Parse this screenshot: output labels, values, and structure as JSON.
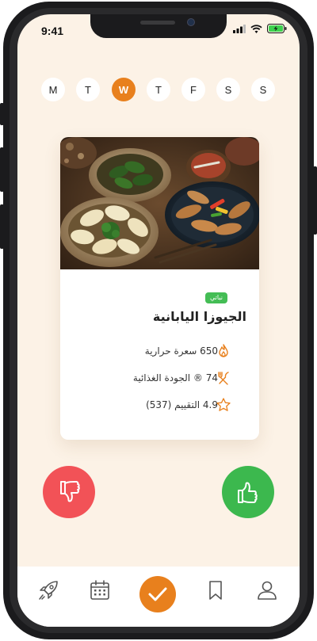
{
  "status_bar": {
    "time": "9:41"
  },
  "week": {
    "days": [
      "M",
      "T",
      "W",
      "T",
      "F",
      "S",
      "S"
    ],
    "selected": "W"
  },
  "dish": {
    "tag": "نباتي",
    "title": "الجيوزا اليابانية",
    "calories": "650 سعرة حرارية",
    "nutrition": "74 ® الجودة الغذائية",
    "rating": "4.9 التقييم (537)"
  },
  "colors": {
    "accent": "#e8801d",
    "dislike": "#f25257",
    "like": "#3cb84e",
    "tag": "#44bd55",
    "screen_bg": "#fcf2e6"
  },
  "actions": {
    "dislike_icon": "thumbs-down-icon",
    "like_icon": "thumbs-up-icon"
  },
  "tabbar": {
    "items": [
      "rocket-icon",
      "calendar-icon",
      "check-icon",
      "bookmark-icon",
      "profile-icon"
    ],
    "active": "check-icon"
  }
}
